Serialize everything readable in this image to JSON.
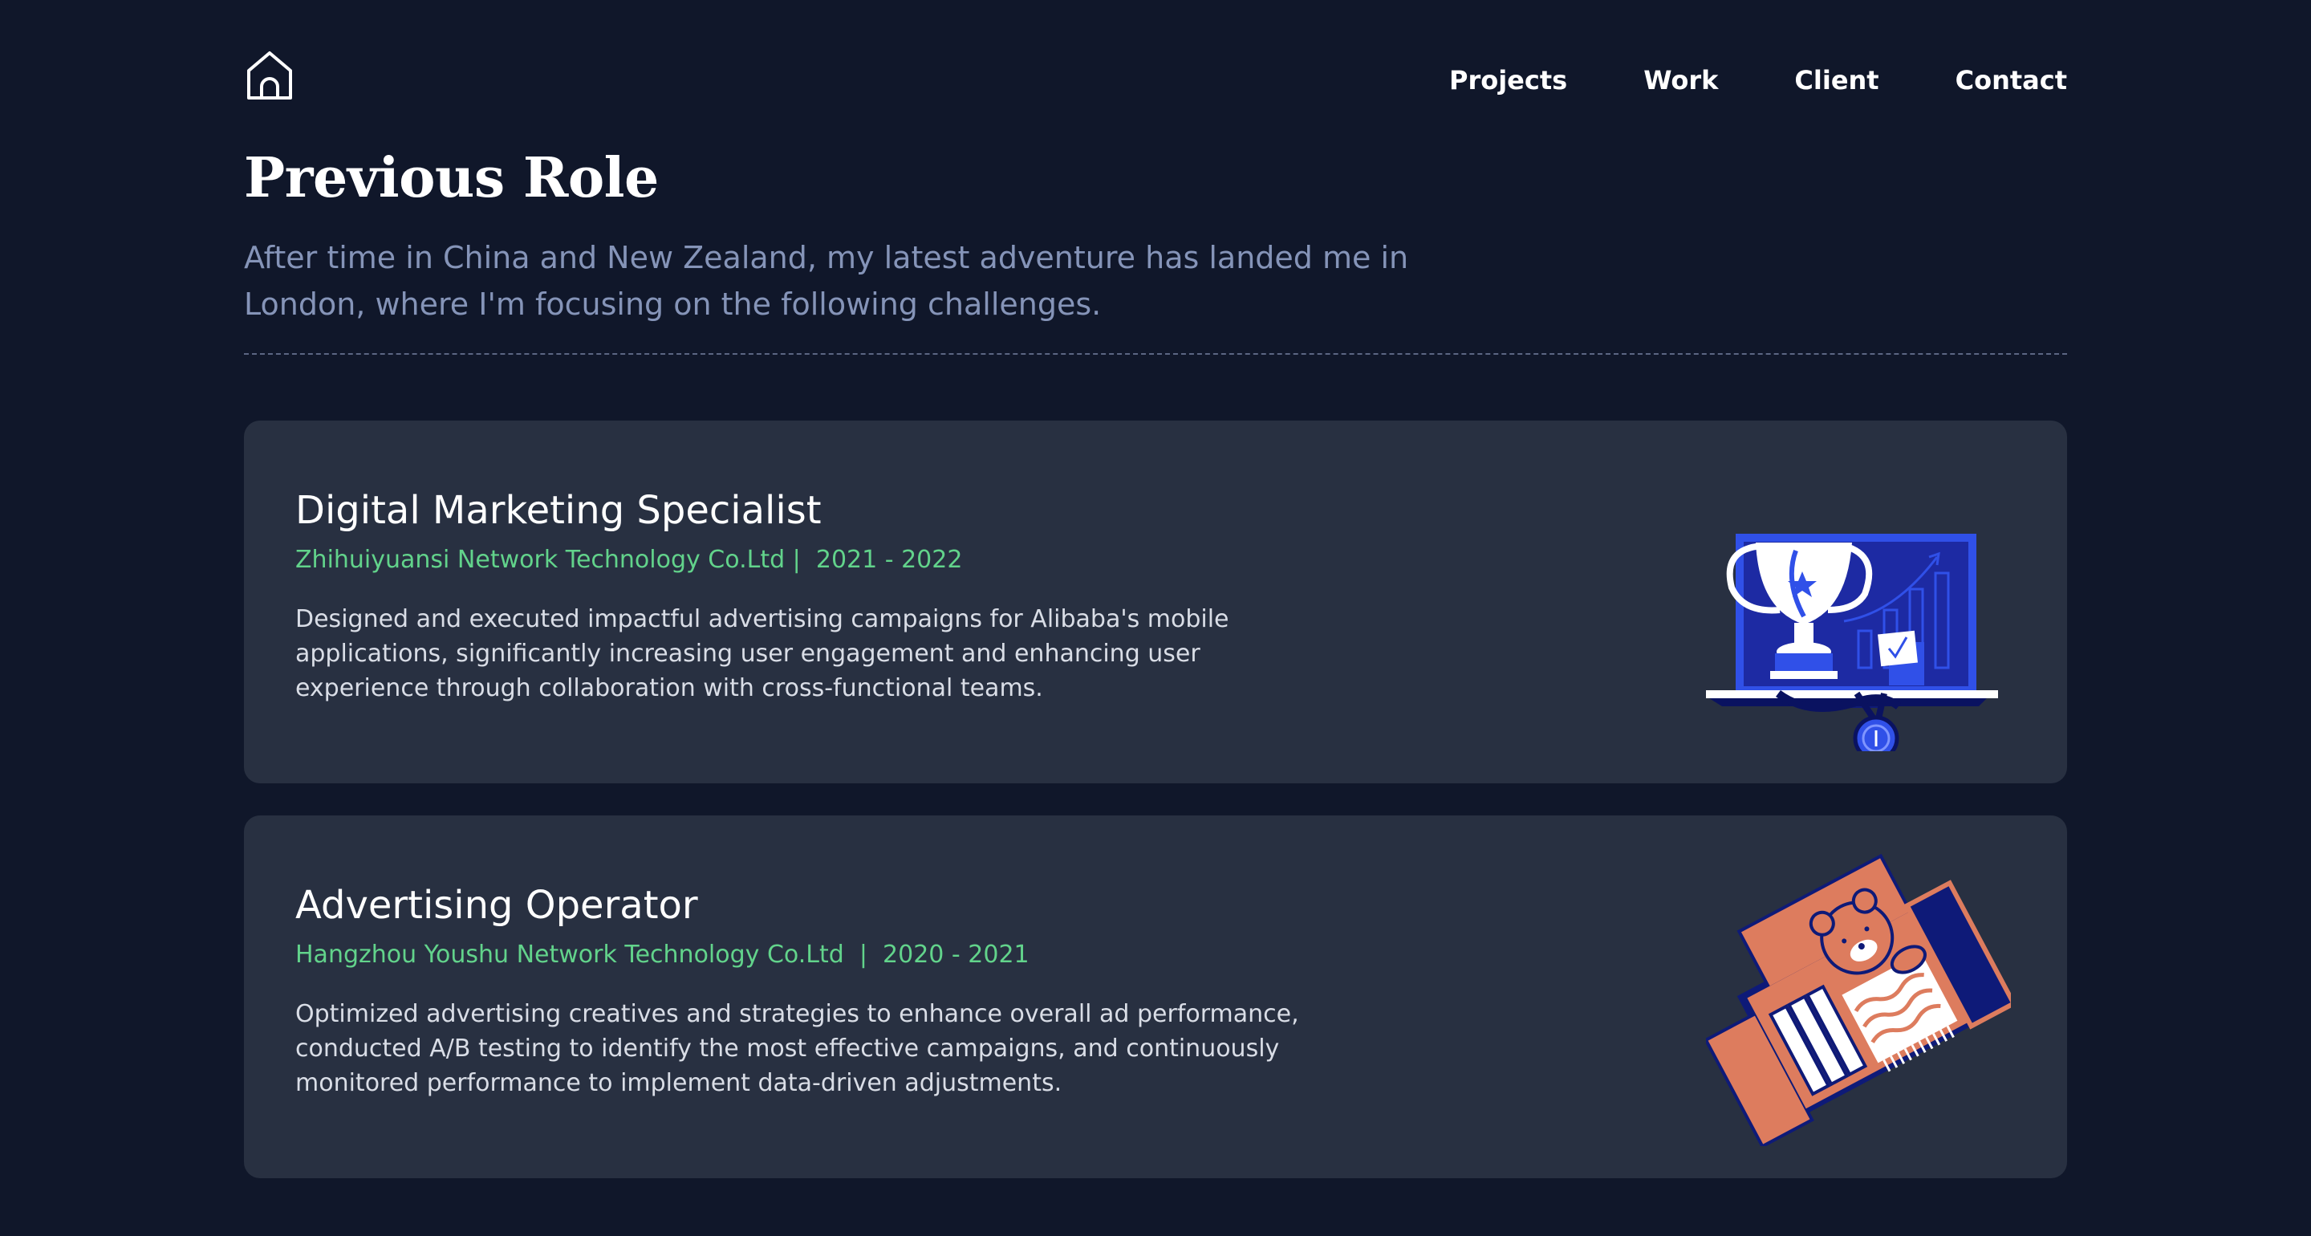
{
  "header": {
    "home_icon": "home-icon",
    "nav": [
      {
        "label": "Projects"
      },
      {
        "label": "Work"
      },
      {
        "label": "Client"
      },
      {
        "label": "Contact"
      }
    ]
  },
  "intro": {
    "title": "Previous Role",
    "subtitle": "After time in China and New Zealand, my latest adventure has landed me in London, where I'm focusing on the following challenges."
  },
  "roles": [
    {
      "title": "Digital Marketing Specialist",
      "meta": "Zhihuiyuansi Network Technology Co.Ltd |  2021 - 2022",
      "description": "Designed and executed impactful advertising campaigns for Alibaba's mobile applications, significantly increasing user engagement and enhancing user experience through collaboration with cross-functional teams.",
      "illustration": "trophy-illustration"
    },
    {
      "title": "Advertising Operator",
      "meta": "Hangzhou Youshu Network Technology Co.Ltd  |  2020 - 2021",
      "description": "Optimized advertising creatives and strategies to enhance overall ad performance, conducted A/B testing to identify the most effective campaigns, and continuously monitored performance to implement data-driven adjustments.",
      "illustration": "bear-box-illustration"
    }
  ],
  "colors": {
    "background": "#10172a",
    "card": "#283041",
    "accent_green": "#62d38b",
    "subtitle": "#8594b8",
    "illustration_blue": "#3050e8",
    "illustration_orange": "#dd7c5e"
  }
}
